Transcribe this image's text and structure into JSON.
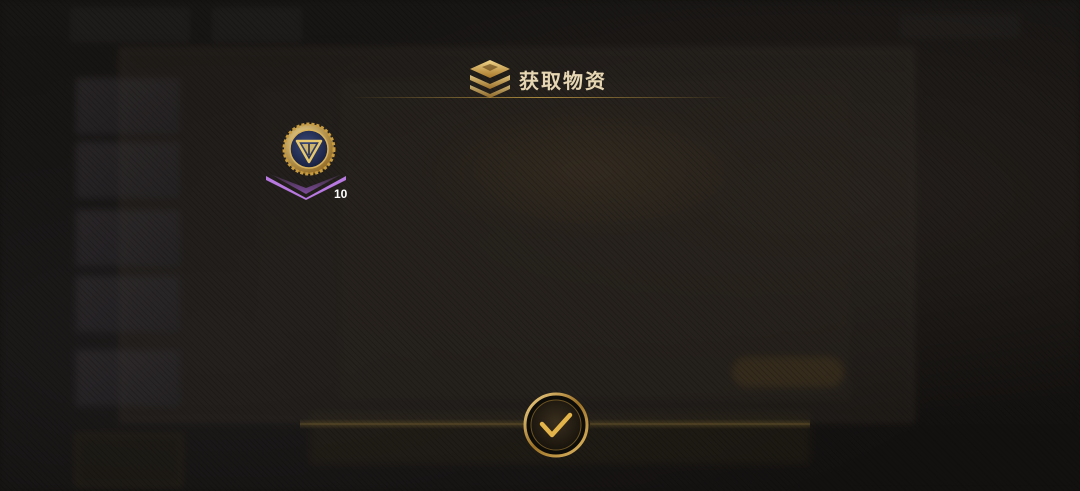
{
  "dialog": {
    "title": "获取物资",
    "title_icon": "stacked-layers-icon",
    "confirm_icon": "checkmark-icon"
  },
  "rewards": [
    {
      "icon": "emblem-coin-icon",
      "count": "10",
      "rarity_color": "#9b59c9"
    }
  ],
  "colors": {
    "accent_gold": "#d4a93c",
    "title_text": "#e6d6b2",
    "rarity_purple": "#9b59c9"
  }
}
